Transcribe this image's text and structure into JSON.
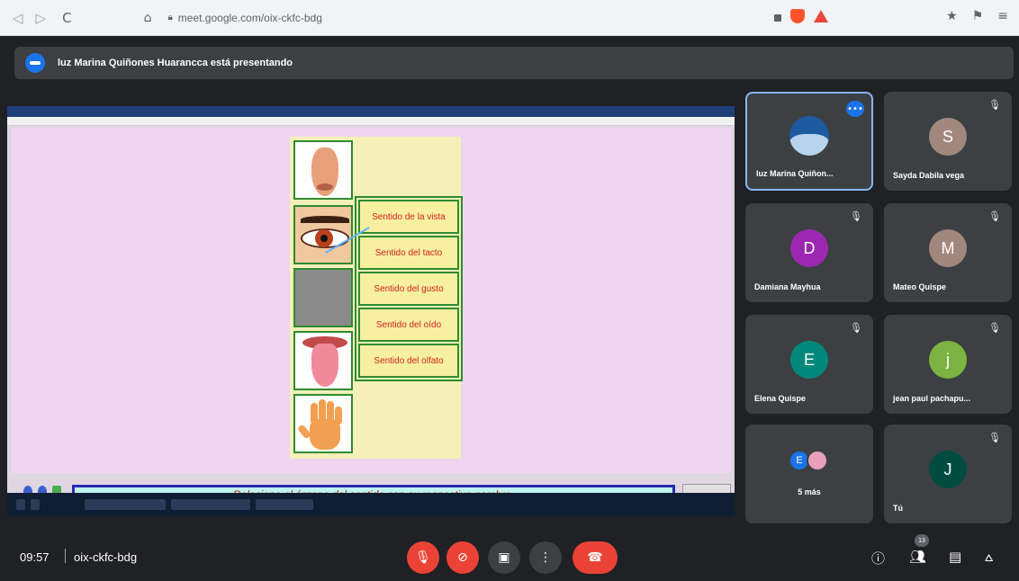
{
  "browser": {
    "back": "◁",
    "forward": "▷",
    "reload": "C",
    "bookmark": "⌂",
    "url": "meet.google.com/oix-ckfc-bdg",
    "right_icons": [
      "★",
      "⚑",
      "≡"
    ]
  },
  "banner": {
    "text": "luz Marina Quiñones Huarancca está presentando"
  },
  "presentation": {
    "labels": [
      "Sentido de la vista",
      "Sentido del tacto",
      "Sentido del gusto",
      "Sentido del oído",
      "Sentido del olfato"
    ],
    "instruction": "Relaciona el órgano del sentido con su respectivo nombre."
  },
  "participants": [
    {
      "name": "luz Marina Quiñon...",
      "initial": "",
      "color": "#1e5aa0",
      "presenter": true
    },
    {
      "name": "Sayda Dabila vega",
      "initial": "S",
      "color": "#a1887f"
    },
    {
      "name": "Damiana Mayhua",
      "initial": "D",
      "color": "#9c27b0"
    },
    {
      "name": "Mateo Quispe",
      "initial": "M",
      "color": "#a1887f"
    },
    {
      "name": "Elena Quispe",
      "initial": "E",
      "color": "#00897b"
    },
    {
      "name": "jean paul pachapu...",
      "initial": "j",
      "color": "#7cb342"
    },
    {
      "name": "5 más",
      "initial": "E",
      "color": "#1a73e8"
    },
    {
      "name": "Tú",
      "initial": "J",
      "color": "#004d40"
    }
  ],
  "bottom": {
    "time": "09:57",
    "meeting_code": "oix-ckfc-bdg",
    "people_count": "13"
  },
  "colors": {
    "meet_bg": "#202124",
    "tile_bg": "#3c4043",
    "danger": "#ea4335",
    "accent": "#1a73e8"
  }
}
